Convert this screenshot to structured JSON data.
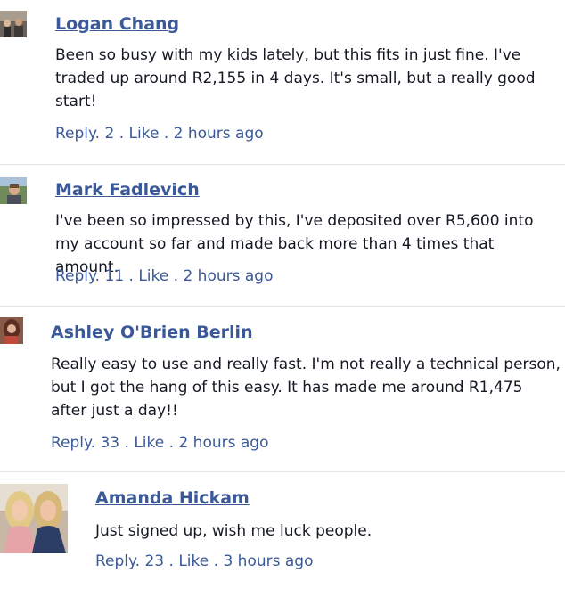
{
  "comments": [
    {
      "name": "Logan Chang",
      "text": "Been so busy with my kids lately, but this fits in just fine. I've traded up around R2,155 in 4 days. It's small, but a really good start!",
      "reply": "Reply.",
      "count": "2",
      "like": "Like",
      "time": "2 hours ago"
    },
    {
      "name": "Mark Fadlevich",
      "text": "I've been so impressed by this, I've deposited over R5,600 into my account so far and made back more than 4 times that amount.",
      "reply": "Reply.",
      "count": "11",
      "like": "Like",
      "time": "2 hours ago"
    },
    {
      "name": "Ashley O'Brien Berlin",
      "text": "Really easy to use and really fast. I'm not really a technical person, but I got the hang of this easy. It has made me around R1,475 after just a day!!",
      "reply": "Reply.",
      "count": "33",
      "like": "Like",
      "time": "2 hours ago"
    },
    {
      "name": "Amanda Hickam",
      "text": "Just signed up, wish me luck people.",
      "reply": "Reply.",
      "count": "23",
      "like": "Like",
      "time": "3 hours ago"
    }
  ],
  "separator": ".",
  "colors": {
    "link": "#3b5998",
    "text": "#141823",
    "divider": "#e3e3e3"
  }
}
